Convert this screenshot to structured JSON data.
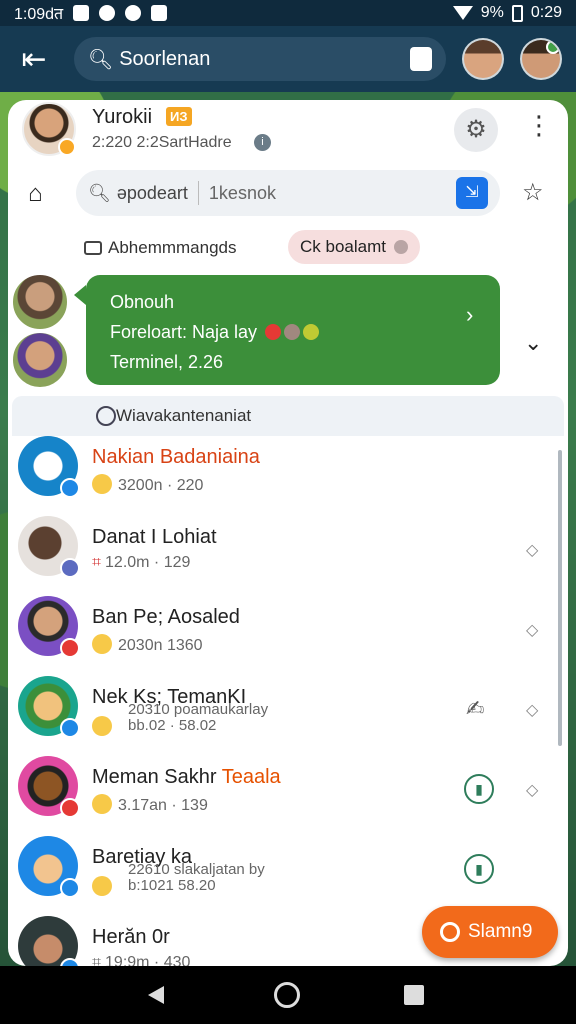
{
  "status_bar": {
    "time": "1:09dत",
    "battery_pct": "9%",
    "clock_right": "0:29"
  },
  "app_bar": {
    "back_icon": "back-arrow-icon",
    "search_placeholder": "Soorlenan"
  },
  "profile": {
    "name": "Yurokii",
    "badge": "ИЗ",
    "subtitle": "2:220 2:2SartHadre"
  },
  "inner_search": {
    "label": "əpodeart",
    "query": "1kesnok"
  },
  "filter": {
    "label": "Abhemmmangds",
    "chip": "Ck boalamt"
  },
  "pinned": {
    "line1": "Obnouh",
    "line2": "Foreloart: Naja lay",
    "line3": "Terminel, 2.26"
  },
  "list_header": "Wiavakantenaniat",
  "chats": [
    {
      "name": "Nakian Badaniaina",
      "meta": "3200n · 220"
    },
    {
      "name": "Danat I Lohiat",
      "meta": "12.0m · 129"
    },
    {
      "name": "Ban Pe; Aosaled",
      "meta": "2030n 1360"
    },
    {
      "name": "Nek Ks; TemanKI",
      "meta": "20310 poamaukarlay",
      "meta_b": "bb.02 · 58.02"
    },
    {
      "name": "Meman Sakhr",
      "name_accent": "Teaala",
      "meta": "3.17an · 139"
    },
    {
      "name": "Baretiay ka",
      "meta": "22610 slakaljatan by",
      "meta_b": "b:1021 58.20"
    },
    {
      "name": "Herăn 0r",
      "meta": "19:9m · 430"
    }
  ],
  "fab": {
    "label": "Slamn9"
  },
  "colors": {
    "accent_green": "#3c8f3a",
    "fab_orange": "#f26a1b",
    "app_bar": "#163a52"
  }
}
